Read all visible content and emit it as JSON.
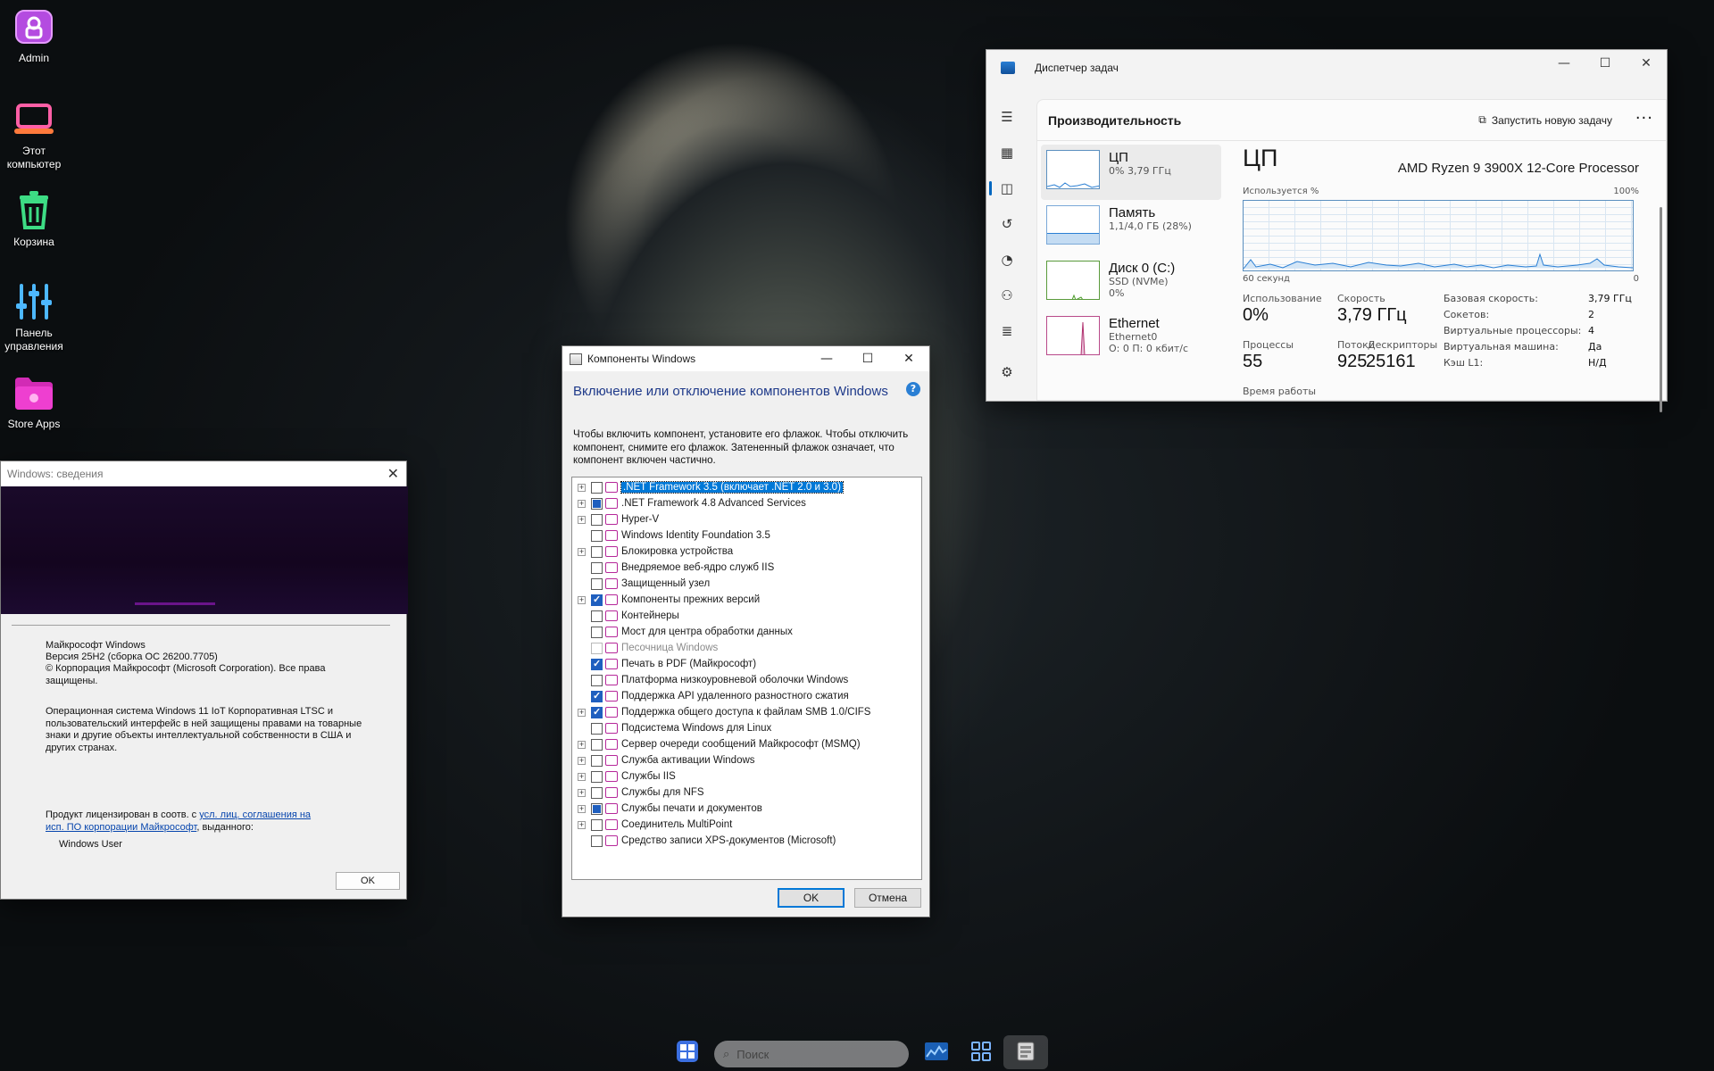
{
  "desktop": {
    "icons": [
      {
        "label": "Admin",
        "icon": "user-folder-icon"
      },
      {
        "label": "Этот компьютер",
        "icon": "laptop-icon"
      },
      {
        "label": "Корзина",
        "icon": "recycle-bin-icon"
      },
      {
        "label": "Панель управления",
        "icon": "control-panel-icon"
      },
      {
        "label": "Store Apps",
        "icon": "store-folder-icon"
      }
    ]
  },
  "taskmgr": {
    "title": "Диспетчер задач",
    "header_title": "Производительность",
    "run_task": "Запустить новую задачу",
    "items": [
      {
        "name": "ЦП",
        "sub1": "0% 3,79 ГГц",
        "sub2": ""
      },
      {
        "name": "Память",
        "sub1": "1,1/4,0 ГБ (28%)",
        "sub2": ""
      },
      {
        "name": "Диск 0 (C:)",
        "sub1": "SSD (NVMe)",
        "sub2": "0%"
      },
      {
        "name": "Ethernet",
        "sub1": "Ethernet0",
        "sub2": "О: 0 П: 0 кбит/с"
      }
    ],
    "cpu_title": "ЦП",
    "cpu_name": "AMD Ryzen 9 3900X 12-Core Processor",
    "graph_label_left": "Используется %",
    "graph_label_right": "100%",
    "graph_time": "60 секунд",
    "graph_zero": "0",
    "usage_label": "Использование",
    "usage_value": "0%",
    "speed_label": "Скорость",
    "speed_value": "3,79 ГГц",
    "processes_label": "Процессы",
    "processes_value": "55",
    "threads_label": "Потоки",
    "threads_value": "925",
    "handles_label": "Дескрипторы",
    "handles_value": "25161",
    "uptime_label": "Время работы",
    "specs": [
      {
        "k": "Базовая скорость:",
        "v": "3,79 ГГц"
      },
      {
        "k": "Сокетов:",
        "v": "2"
      },
      {
        "k": "Виртуальные процессоры:",
        "v": "4"
      },
      {
        "k": "Виртуальная машина:",
        "v": "Да"
      },
      {
        "k": "Кэш L1:",
        "v": "Н/Д"
      }
    ]
  },
  "features": {
    "title": "Компоненты Windows",
    "heading": "Включение или отключение компонентов Windows",
    "description": "Чтобы включить компонент, установите его флажок. Чтобы отключить компонент, снимите его флажок. Затененный флажок означает, что компонент включен частично.",
    "items": [
      {
        "label": ".NET Framework 3.5 (включает .NET 2.0 и 3.0)",
        "state": "unchecked",
        "expand": true,
        "selected": true
      },
      {
        "label": ".NET Framework 4.8 Advanced Services",
        "state": "partial",
        "expand": true
      },
      {
        "label": "Hyper-V",
        "state": "unchecked",
        "expand": true
      },
      {
        "label": "Windows Identity Foundation 3.5",
        "state": "unchecked",
        "expand": false
      },
      {
        "label": "Блокировка устройства",
        "state": "unchecked",
        "expand": true
      },
      {
        "label": "Внедряемое веб-ядро служб IIS",
        "state": "unchecked",
        "expand": false
      },
      {
        "label": "Защищенный узел",
        "state": "unchecked",
        "expand": false
      },
      {
        "label": "Компоненты прежних версий",
        "state": "checked",
        "expand": true
      },
      {
        "label": "Контейнеры",
        "state": "unchecked",
        "expand": false
      },
      {
        "label": "Мост для центра обработки данных",
        "state": "unchecked",
        "expand": false
      },
      {
        "label": "Песочница Windows",
        "state": "disabled",
        "expand": false
      },
      {
        "label": "Печать в PDF (Майкрософт)",
        "state": "checked",
        "expand": false
      },
      {
        "label": "Платформа низкоуровневой оболочки Windows",
        "state": "unchecked",
        "expand": false
      },
      {
        "label": "Поддержка API удаленного разностного сжатия",
        "state": "checked",
        "expand": false
      },
      {
        "label": "Поддержка общего доступа к файлам SMB 1.0/CIFS",
        "state": "checked",
        "expand": true
      },
      {
        "label": "Подсистема Windows для Linux",
        "state": "unchecked",
        "expand": false
      },
      {
        "label": "Сервер очереди сообщений Майкрософт (MSMQ)",
        "state": "unchecked",
        "expand": true
      },
      {
        "label": "Служба активации Windows",
        "state": "unchecked",
        "expand": true
      },
      {
        "label": "Службы IIS",
        "state": "unchecked",
        "expand": true
      },
      {
        "label": "Службы для NFS",
        "state": "unchecked",
        "expand": true
      },
      {
        "label": "Службы печати и документов",
        "state": "partial",
        "expand": true
      },
      {
        "label": "Соединитель MultiPoint",
        "state": "unchecked",
        "expand": true
      },
      {
        "label": "Средство записи XPS-документов (Microsoft)",
        "state": "unchecked",
        "expand": false
      }
    ],
    "ok_label": "OK",
    "cancel_label": "Отмена"
  },
  "about": {
    "title": "Windows: сведения",
    "line1": "Майкрософт Windows",
    "line2": "Версия 25H2 (сборка ОС 26200.7705)",
    "line3": "© Корпорация Майкрософт (Microsoft Corporation). Все права защищены.",
    "para": "Операционная система Windows 11 IoT Корпоративная LTSC и пользовательский интерфейс в ней защищены правами на товарные знаки и другие объекты интеллектуальной собственности в США и других странах.",
    "license_prefix": "Продукт лицензирован в соотв. с ",
    "license_link": "усл. лиц. соглашения на исп. ПО корпорации Майкрософт",
    "license_suffix": ", выданного:",
    "user": "Windows User",
    "ok_label": "OK"
  },
  "taskbar": {
    "search_placeholder": "Поиск",
    "items": [
      "start-icon",
      "search-icon",
      "taskmgr-icon",
      "task-view-icon",
      "features-icon"
    ]
  }
}
